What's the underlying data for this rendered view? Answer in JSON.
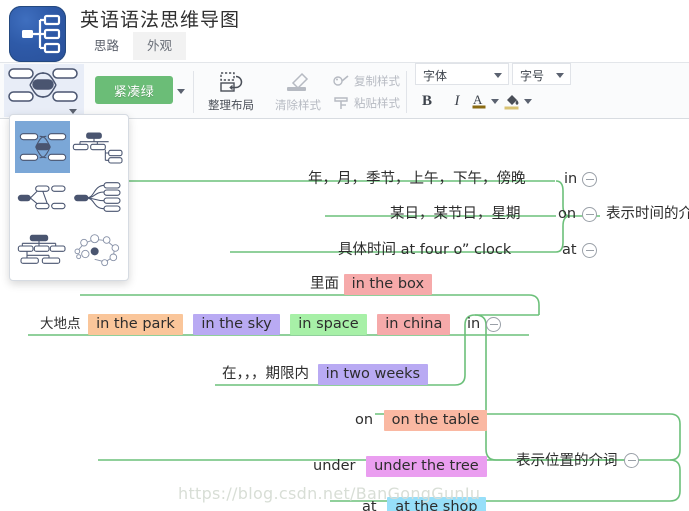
{
  "window": {
    "app_title": "英语语法思维导图",
    "logo_icon": "mindmap-logo-icon"
  },
  "tabs": [
    {
      "label": "思路",
      "active": false
    },
    {
      "label": "外观",
      "active": true
    }
  ],
  "ribbon": {
    "layout_picker": {
      "icon": "layout-balanced-icon",
      "caret": "chevron-down-icon"
    },
    "theme_button": {
      "label": "紧凑绿",
      "color": "#6bbd77",
      "caret": "chevron-down-icon"
    },
    "organize_layout": {
      "label": "整理布局",
      "icon": "organize-layout-icon",
      "disabled": false
    },
    "clear_style": {
      "label": "清除样式",
      "icon": "clear-style-icon",
      "disabled": true
    },
    "copy_style": {
      "label": "复制样式",
      "icon": "copy-style-icon",
      "disabled": true
    },
    "paste_style": {
      "label": "粘贴样式",
      "icon": "paste-style-icon",
      "disabled": true
    },
    "font_family": {
      "label": "字体",
      "value": "",
      "caret": "chevron-down-icon"
    },
    "font_size": {
      "label": "字号",
      "value": "",
      "caret": "chevron-down-icon"
    },
    "bold": {
      "label": "B"
    },
    "italic": {
      "label": "I"
    },
    "text_color": {
      "label": "A",
      "swatch": "#8a6a12",
      "icon": "text-color-icon"
    },
    "fill_color": {
      "swatch": "#d9c373",
      "icon": "fill-color-icon"
    }
  },
  "layout_panel": {
    "options": [
      {
        "name": "layout-balanced",
        "selected": true
      },
      {
        "name": "layout-org-right",
        "selected": false
      },
      {
        "name": "layout-tree-horizontal",
        "selected": false
      },
      {
        "name": "layout-fishbone-right",
        "selected": false
      },
      {
        "name": "layout-org-chart",
        "selected": false
      },
      {
        "name": "layout-organic-bubble",
        "selected": false
      }
    ]
  },
  "mindmap": {
    "branches": [
      {
        "label": "表示时间的介",
        "collapse_icon": "collapse-minus-icon",
        "children": [
          {
            "prefix": "年，月，季节，上午，下午，傍晚",
            "keyword": "in",
            "highlight": "",
            "highlight_color": ""
          },
          {
            "prefix": "某日，某节日，星期",
            "keyword": "on",
            "highlight": "",
            "highlight_color": ""
          },
          {
            "prefix": "具体时间  at four o” clock",
            "keyword": "at",
            "highlight": "",
            "highlight_color": ""
          }
        ]
      },
      {
        "label": "表示位置的介词",
        "collapse_icon": "collapse-minus-icon",
        "children": [
          {
            "prefix": "里面",
            "keyword": "in",
            "highlight": "in the box",
            "highlight_color": "#f6aaaa"
          },
          {
            "prefix": "大地点",
            "keyword": "in",
            "highlight": "in the park",
            "highlight_color": "#fac69a"
          },
          {
            "prefix": "",
            "keyword": "",
            "highlight": "in the sky",
            "highlight_color": "#b9aaf3"
          },
          {
            "prefix": "",
            "keyword": "",
            "highlight": "in space",
            "highlight_color": "#a7f0a7"
          },
          {
            "prefix": "",
            "keyword": "",
            "highlight": "in china",
            "highlight_color": "#f6aaaa"
          },
          {
            "prefix": "在，，，期限内",
            "keyword": "",
            "highlight": "in two weeks",
            "highlight_color": "#b9aaf3"
          },
          {
            "prefix": "on",
            "keyword": "",
            "highlight": "on the table",
            "highlight_color": "#fab8a2"
          },
          {
            "prefix": "under",
            "keyword": "",
            "highlight": "under the tree",
            "highlight_color": "#ea9ef0"
          },
          {
            "prefix": "at",
            "keyword": "",
            "highlight": "at the shop",
            "highlight_color": "#97dff9"
          }
        ]
      }
    ],
    "connector_color": "#6cc07a",
    "watermark": "https://blog.csdn.net/BanGongGunJu"
  }
}
